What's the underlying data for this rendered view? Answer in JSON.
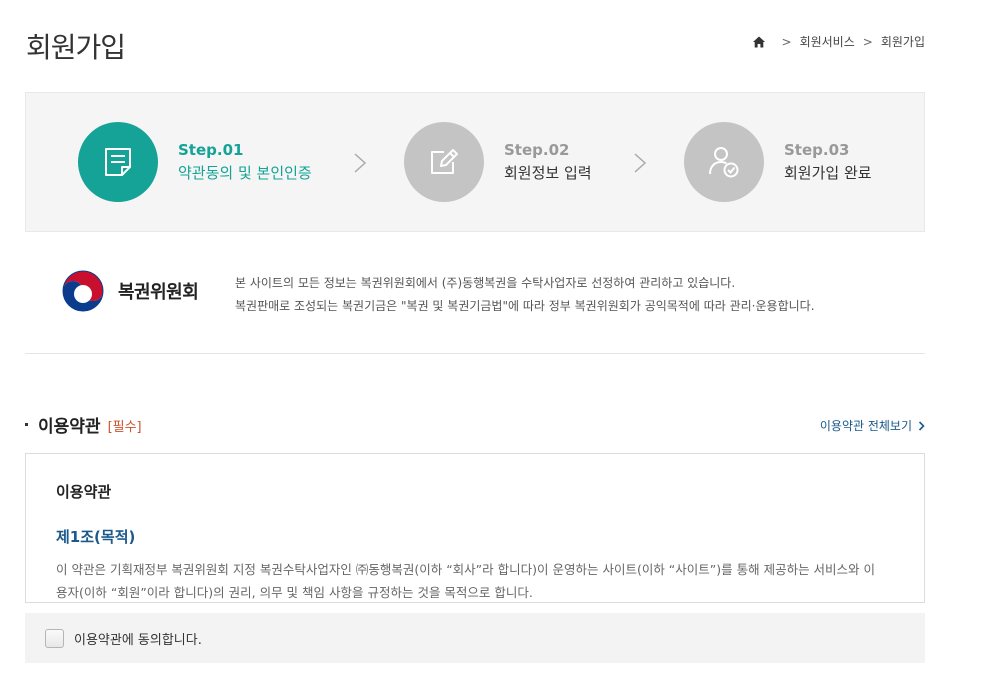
{
  "page": {
    "title": "회원가입"
  },
  "breadcrumb": {
    "items": [
      "회원서비스",
      "회원가입"
    ]
  },
  "steps": [
    {
      "num": "Step.01",
      "label": "약관동의 및 본인인증",
      "icon": "document-icon",
      "active": true
    },
    {
      "num": "Step.02",
      "label": "회원정보 입력",
      "icon": "edit-icon",
      "active": false
    },
    {
      "num": "Step.03",
      "label": "회원가입 완료",
      "icon": "user-check-icon",
      "active": false
    }
  ],
  "info": {
    "logo_text": "복권위원회",
    "lines": [
      "본 사이트의 모든 정보는 복권위원회에서 (주)동행복권을 수탁사업자로 선정하여 관리하고 있습니다.",
      "복권판매로 조성되는 복권기금은 \"복권 및 복권기금법\"에 따라 정부 복권위원회가 공익목적에 따라 관리·운용합니다."
    ]
  },
  "terms_section": {
    "title": "이용약관",
    "required_tag": "[필수]",
    "view_all": "이용약관 전체보기"
  },
  "terms": {
    "heading": "이용약관",
    "article_title": "제1조(목적)",
    "body_line1": "이 약관은 기획재정부 복권위원회 지정 복권수탁사업자인 ㈜동행복권(이하 “회사”라 합니다)이 운영하는 사이트(이하 “사이트”)를 통해 제공하는 서비스와 이",
    "body_line2": "용자(이하 “회원”이라 합니다)의 권리, 의무 및 책임 사항을 규정하는 것을 목적으로 합니다."
  },
  "agree": {
    "label": "이용약관에 동의합니다.",
    "checked": false
  },
  "colors": {
    "accent": "#14a396",
    "inactive": "#c4c4c4",
    "link": "#1a5a8a",
    "required": "#d0502c"
  }
}
